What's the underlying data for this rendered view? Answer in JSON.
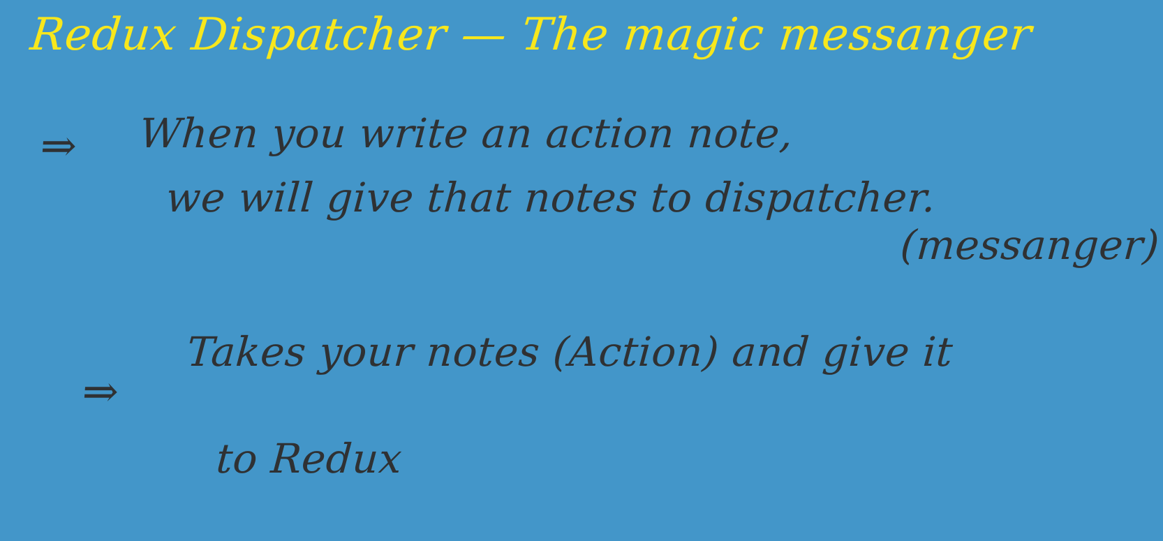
{
  "board": {
    "background_color": "#4396c9",
    "title_color": "#f8e71c",
    "ink_color": "#2f3133"
  },
  "title": "Redux Dispatcher — The magic messanger",
  "bullet1": {
    "arrow": "⇒",
    "line1": "When you write an action note,",
    "line2": "we will give that notes to dispatcher.",
    "line3": "(messanger)"
  },
  "bullet2": {
    "arrow": "⇒",
    "line1": "Takes your notes (Action) and give it",
    "line2": "to Redux"
  }
}
